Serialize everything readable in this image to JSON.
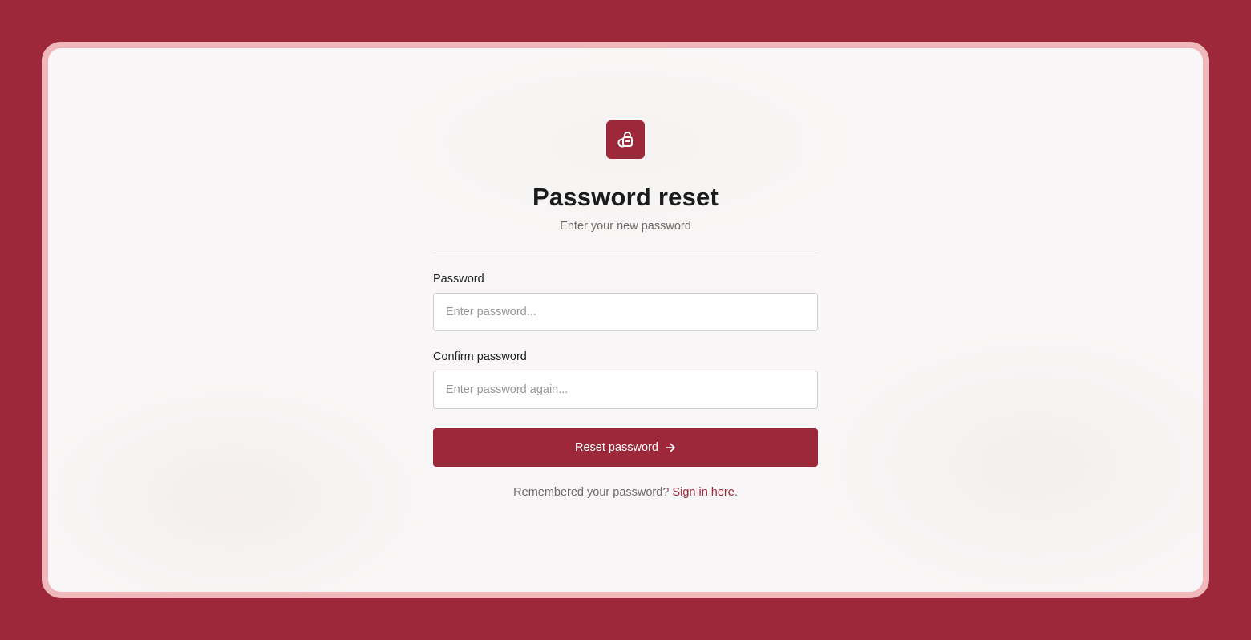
{
  "colors": {
    "brand": "#9c2839",
    "frame": "#f1b8bb",
    "card_background": "#f8f6f6"
  },
  "logo": {
    "icon": "lock-heart-icon"
  },
  "header": {
    "title": "Password reset",
    "subtitle": "Enter your new password"
  },
  "form": {
    "password": {
      "label": "Password",
      "value": "",
      "placeholder": "Enter password..."
    },
    "confirm_password": {
      "label": "Confirm password",
      "value": "",
      "placeholder": "Enter password again..."
    },
    "submit": {
      "label": "Reset password",
      "icon": "arrow-right-icon"
    }
  },
  "footer": {
    "prompt": "Remembered your password?",
    "link_label": "Sign in here",
    "suffix": "."
  }
}
